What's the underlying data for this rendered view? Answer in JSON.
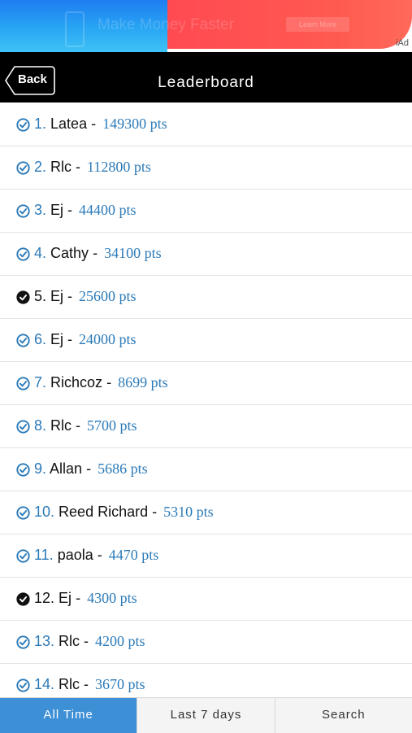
{
  "ad": {
    "headline": "Make Money Faster",
    "cta": "Learn More",
    "label": "iAd"
  },
  "nav": {
    "back_label": "Back",
    "title": "Leaderboard"
  },
  "leaderboard": [
    {
      "rank": "1.",
      "name": "Latea",
      "points": "149300 pts",
      "verified": true
    },
    {
      "rank": "2.",
      "name": "Rlc",
      "points": "112800 pts",
      "verified": true
    },
    {
      "rank": "3.",
      "name": "Ej",
      "points": "44400 pts",
      "verified": true
    },
    {
      "rank": "4.",
      "name": "Cathy",
      "points": "34100 pts",
      "verified": true
    },
    {
      "rank": "5.",
      "name": "Ej",
      "points": "25600 pts",
      "verified": false
    },
    {
      "rank": "6.",
      "name": "Ej",
      "points": "24000 pts",
      "verified": true
    },
    {
      "rank": "7.",
      "name": "Richcoz",
      "points": "8699 pts",
      "verified": true
    },
    {
      "rank": "8.",
      "name": "Rlc",
      "points": "5700 pts",
      "verified": true
    },
    {
      "rank": "9.",
      "name": "Allan",
      "points": "5686 pts",
      "verified": true
    },
    {
      "rank": "10.",
      "name": "Reed Richard",
      "points": "5310 pts",
      "verified": true
    },
    {
      "rank": "11.",
      "name": "paola",
      "points": "4470 pts",
      "verified": true
    },
    {
      "rank": "12.",
      "name": "Ej",
      "points": "4300 pts",
      "verified": false
    },
    {
      "rank": "13.",
      "name": "Rlc",
      "points": "4200 pts",
      "verified": true
    },
    {
      "rank": "14.",
      "name": "Rlc",
      "points": "3670 pts",
      "verified": true
    }
  ],
  "tabs": [
    {
      "label": "All Time",
      "active": true
    },
    {
      "label": "Last 7 days",
      "active": false
    },
    {
      "label": "Search",
      "active": false
    }
  ],
  "colors": {
    "accent": "#2b7ab8",
    "active_tab": "#3d8fd6",
    "nav_bg": "#000000"
  }
}
